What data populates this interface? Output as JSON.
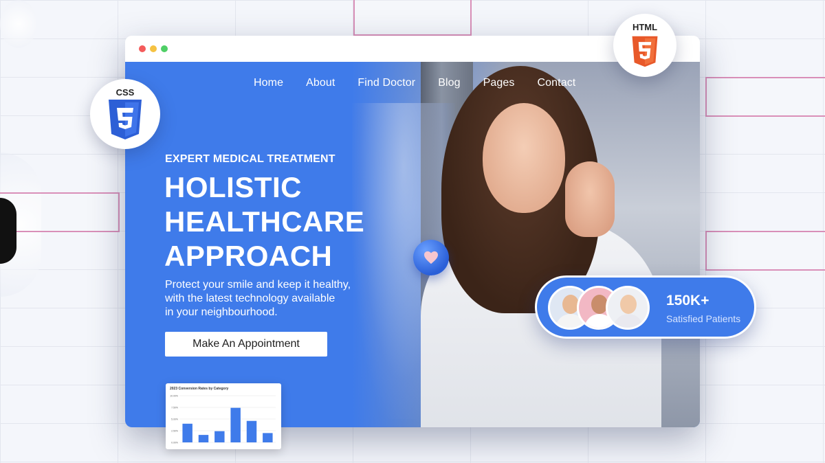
{
  "nav": {
    "items": [
      "Home",
      "About",
      "Find Doctor",
      "Blog",
      "Pages",
      "Contact"
    ]
  },
  "hero": {
    "eyebrow": "EXPERT MEDICAL TREATMENT",
    "headline_lines": [
      "HOLISTIC",
      "HEALTHCARE",
      "APPROACH"
    ],
    "subtext_lines": [
      "Protect your smile and keep it healthy,",
      "with the latest technology available",
      "in your neighbourhood."
    ],
    "cta_label": "Make An Appointment"
  },
  "badges": {
    "css_label": "CSS",
    "html_label": "HTML",
    "css_icon": "css3-shield-icon",
    "html_icon": "html5-shield-icon",
    "css_color": "#2d5fd6",
    "html_color": "#e8592a"
  },
  "stats": {
    "value": "150K+",
    "label": "Satisfied Patients"
  },
  "heart_icon": "heart-icon",
  "colors": {
    "primary": "#3f7bea",
    "white": "#ffffff"
  },
  "chart_data": {
    "type": "bar",
    "title": "2023 Conversion Rates by Category",
    "yticks": [
      "10.00%",
      "7.50%",
      "5.00%",
      "2.50%",
      "0.00%"
    ],
    "ylim": [
      0,
      10
    ],
    "values": [
      4.0,
      1.6,
      2.4,
      7.4,
      4.6,
      2.0
    ],
    "bar_color": "#3f7bea"
  }
}
